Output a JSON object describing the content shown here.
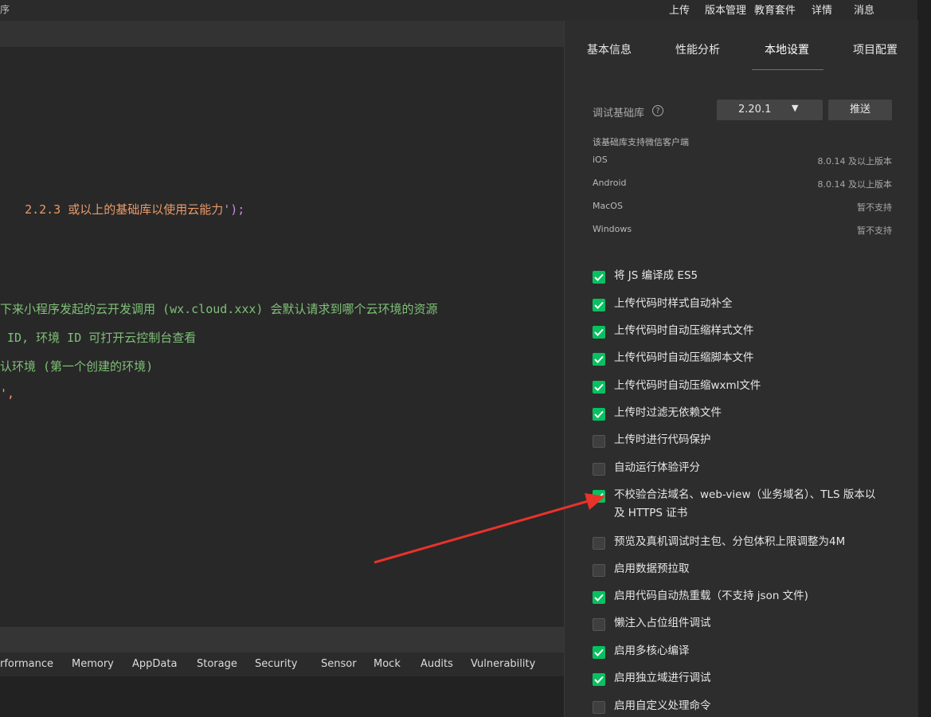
{
  "topbar": {
    "app_fragment": "序",
    "menu": [
      "上传",
      "版本管理",
      "教育套件",
      "详情",
      "消息"
    ]
  },
  "editor": {
    "lines": [
      {
        "segments": [
          {
            "t": "2.2.3 或以上的基础库以使用云能力",
            "c": "orange"
          },
          {
            "t": "');",
            "c": "purple"
          }
        ]
      },
      {
        "segments": [
          {
            "t": "下来小程序发起的云开发调用 (wx.cloud.xxx) 会默认请求到哪个云环境的资源",
            "c": "green"
          }
        ]
      },
      {
        "segments": [
          {
            "t": " ID, 环境 ID 可打开云控制台查看",
            "c": "green"
          }
        ]
      },
      {
        "segments": [
          {
            "t": "认环境 (第一个创建的环境)",
            "c": "green"
          }
        ]
      },
      {
        "segments": [
          {
            "t": "',",
            "c": "orange"
          }
        ]
      }
    ]
  },
  "devtools": {
    "tabs": [
      "rformance",
      "Memory",
      "AppData",
      "Storage",
      "Security",
      "Sensor",
      "Mock",
      "Audits",
      "Vulnerability"
    ]
  },
  "panel": {
    "tabs": [
      "基本信息",
      "性能分析",
      "本地设置",
      "项目配置"
    ],
    "active_tab": "本地设置",
    "debug_lib_label": "调试基础库",
    "debug_lib_version": "2.20.1",
    "push_label": "推送",
    "support_heading": "该基础库支持微信客户端",
    "support_rows": [
      {
        "platform": "iOS",
        "value": "8.0.14 及以上版本"
      },
      {
        "platform": "Android",
        "value": "8.0.14 及以上版本"
      },
      {
        "platform": "MacOS",
        "value": "暂不支持"
      },
      {
        "platform": "Windows",
        "value": "暂不支持"
      }
    ],
    "options": [
      {
        "label": "将 JS 编译成 ES5",
        "checked": true
      },
      {
        "label": "上传代码时样式自动补全",
        "checked": true
      },
      {
        "label": "上传代码时自动压缩样式文件",
        "checked": true
      },
      {
        "label": "上传代码时自动压缩脚本文件",
        "checked": true
      },
      {
        "label": "上传代码时自动压缩wxml文件",
        "checked": true
      },
      {
        "label": "上传时过滤无依赖文件",
        "checked": true
      },
      {
        "label": "上传时进行代码保护",
        "checked": false
      },
      {
        "label": "自动运行体验评分",
        "checked": false
      },
      {
        "label": "不校验合法域名、web-view（业务域名）、TLS 版本以及 HTTPS 证书",
        "checked": true
      },
      {
        "label": "预览及真机调试时主包、分包体积上限调整为4M",
        "checked": false
      },
      {
        "label": "启用数据预拉取",
        "checked": false
      },
      {
        "label": "启用代码自动热重载（不支持 json 文件)",
        "checked": true
      },
      {
        "label": "懒注入占位组件调试",
        "checked": false
      },
      {
        "label": "启用多核心编译",
        "checked": true
      },
      {
        "label": "启用独立域进行调试",
        "checked": true
      },
      {
        "label": "启用自定义处理命令",
        "checked": false
      }
    ]
  },
  "annotation": {
    "arrow_color": "#e8332a"
  }
}
